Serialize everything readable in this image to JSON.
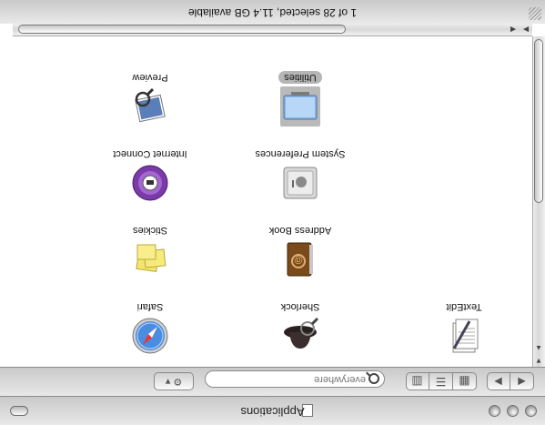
{
  "window": {
    "title": "Applications",
    "status_text": "1 of 28 selected, 11.4 GB available"
  },
  "toolbar": {
    "back_label": "◀",
    "forward_label": "▶",
    "view_icon_label": "▦",
    "view_list_label": "☰",
    "view_column_label": "▥",
    "action_label": "⚙ ▾"
  },
  "search": {
    "placeholder": "everywhere"
  },
  "scroll": {
    "up": "▲",
    "down": "▼",
    "left": "◀",
    "right": "▶"
  },
  "items": [
    {
      "label": "TextEdit",
      "icon": "textedit-icon"
    },
    {
      "label": "Sherlock",
      "icon": "sherlock-icon"
    },
    {
      "label": "Safari",
      "icon": "safari-icon"
    },
    {
      "label": "Address Book",
      "icon": "address-book-icon"
    },
    {
      "label": "Stickies",
      "icon": "stickies-icon"
    },
    {
      "label": "System Preferences",
      "icon": "system-preferences-icon"
    },
    {
      "label": "Internet Connect",
      "icon": "internet-connect-icon"
    },
    {
      "label": "Utilities",
      "icon": "folder-icon",
      "selected": true
    },
    {
      "label": "Preview",
      "icon": "preview-icon"
    }
  ]
}
